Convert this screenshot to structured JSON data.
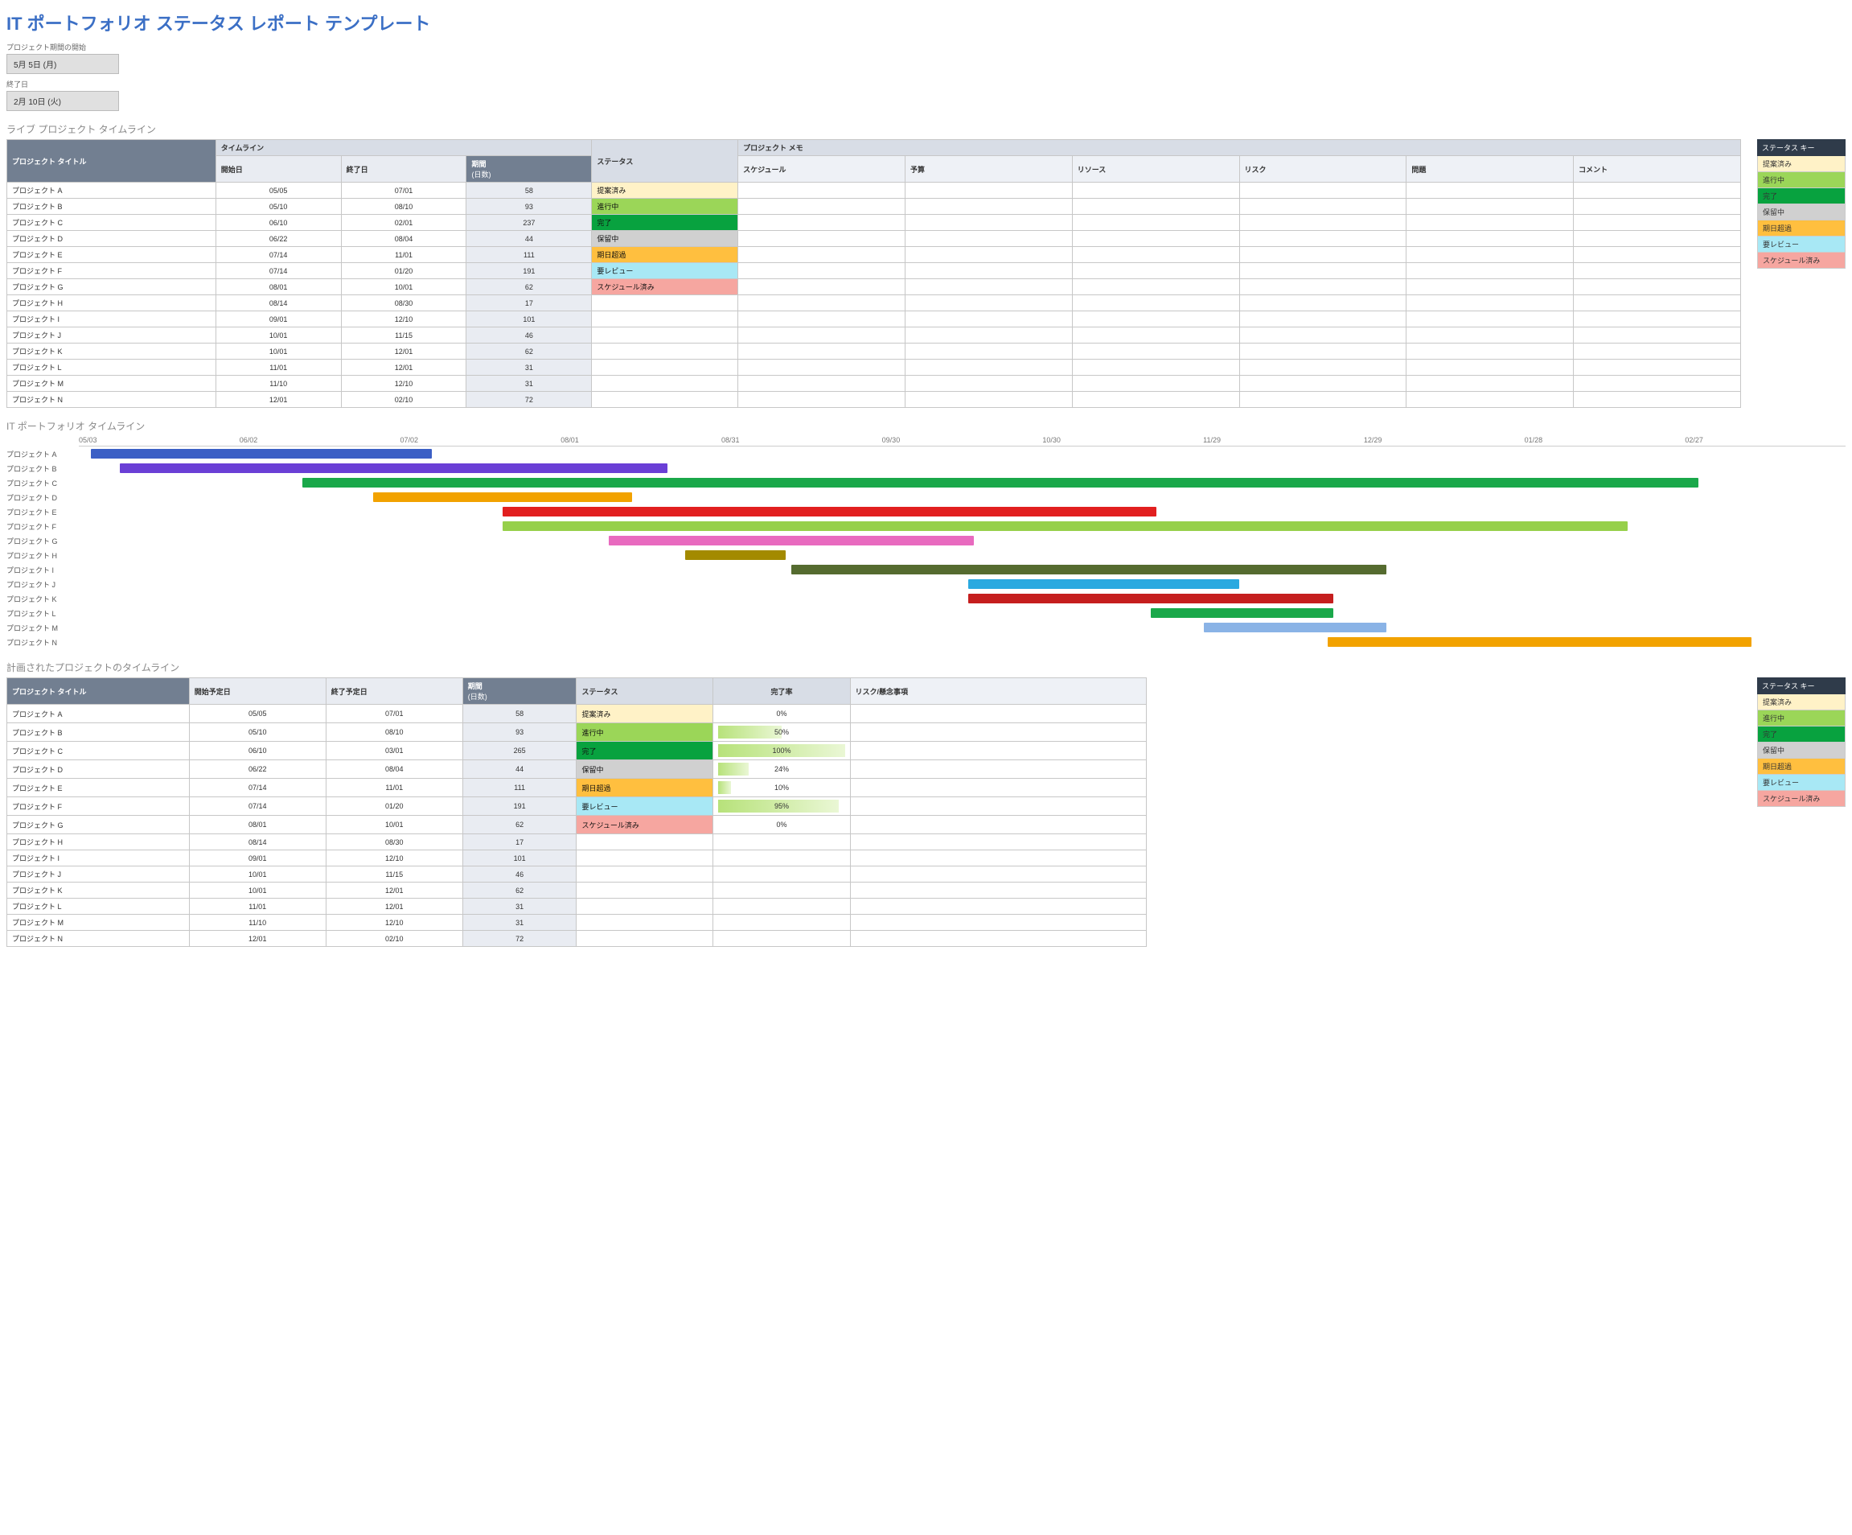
{
  "title": "IT ポートフォリオ ステータス レポート テンプレート",
  "meta": {
    "start_label": "プロジェクト期間の開始",
    "start_value": "5月 5日 (月)",
    "end_label": "終了日",
    "end_value": "2月 10日 (火)"
  },
  "section_live_title": "ライブ プロジェクト タイムライン",
  "live_headers": {
    "group_timeline": "タイムライン",
    "group_memo": "プロジェクト メモ",
    "project_title": "プロジェクト タイトル",
    "start": "開始日",
    "end": "終了日",
    "duration": "期間",
    "duration_sub": "(日数)",
    "status": "ステータス",
    "schedule": "スケジュール",
    "budget": "予算",
    "resource": "リソース",
    "risk": "リスク",
    "issue": "問題",
    "comment": "コメント"
  },
  "live_rows": [
    {
      "title": "プロジェクト A",
      "start": "05/05",
      "end": "07/01",
      "dur": "58",
      "status": "提案済み",
      "scls": "s-proposed"
    },
    {
      "title": "プロジェクト B",
      "start": "05/10",
      "end": "08/10",
      "dur": "93",
      "status": "進行中",
      "scls": "s-progress"
    },
    {
      "title": "プロジェクト C",
      "start": "06/10",
      "end": "02/01",
      "dur": "237",
      "status": "完了",
      "scls": "s-complete"
    },
    {
      "title": "プロジェクト D",
      "start": "06/22",
      "end": "08/04",
      "dur": "44",
      "status": "保留中",
      "scls": "s-hold"
    },
    {
      "title": "プロジェクト E",
      "start": "07/14",
      "end": "11/01",
      "dur": "111",
      "status": "期日超過",
      "scls": "s-overdue"
    },
    {
      "title": "プロジェクト F",
      "start": "07/14",
      "end": "01/20",
      "dur": "191",
      "status": "要レビュー",
      "scls": "s-review"
    },
    {
      "title": "プロジェクト G",
      "start": "08/01",
      "end": "10/01",
      "dur": "62",
      "status": "スケジュール済み",
      "scls": "s-scheduled"
    },
    {
      "title": "プロジェクト H",
      "start": "08/14",
      "end": "08/30",
      "dur": "17",
      "status": "",
      "scls": ""
    },
    {
      "title": "プロジェクト I",
      "start": "09/01",
      "end": "12/10",
      "dur": "101",
      "status": "",
      "scls": ""
    },
    {
      "title": "プロジェクト J",
      "start": "10/01",
      "end": "11/15",
      "dur": "46",
      "status": "",
      "scls": ""
    },
    {
      "title": "プロジェクト K",
      "start": "10/01",
      "end": "12/01",
      "dur": "62",
      "status": "",
      "scls": ""
    },
    {
      "title": "プロジェクト L",
      "start": "11/01",
      "end": "12/01",
      "dur": "31",
      "status": "",
      "scls": ""
    },
    {
      "title": "プロジェクト M",
      "start": "11/10",
      "end": "12/10",
      "dur": "31",
      "status": "",
      "scls": ""
    },
    {
      "title": "プロジェクト N",
      "start": "12/01",
      "end": "02/10",
      "dur": "72",
      "status": "",
      "scls": ""
    }
  ],
  "section_gantt_title": "IT ポートフォリオ タイムライン",
  "gantt_axis": [
    "05/03",
    "06/02",
    "07/02",
    "08/01",
    "08/31",
    "09/30",
    "10/30",
    "11/29",
    "12/29",
    "01/28",
    "02/27"
  ],
  "chart_data": {
    "type": "gantt",
    "title": "IT ポートフォリオ タイムライン",
    "x_ticks": [
      "05/03",
      "06/02",
      "07/02",
      "08/01",
      "08/31",
      "09/30",
      "10/30",
      "11/29",
      "12/29",
      "01/28",
      "02/27"
    ],
    "xlim_days": [
      0,
      300
    ],
    "tasks": [
      {
        "name": "プロジェクト A",
        "start_day": 2,
        "duration": 58,
        "color": "#3b5fc5"
      },
      {
        "name": "プロジェクト B",
        "start_day": 7,
        "duration": 93,
        "color": "#6a3fd6"
      },
      {
        "name": "プロジェクト C",
        "start_day": 38,
        "duration": 237,
        "color": "#1aa84a"
      },
      {
        "name": "プロジェクト D",
        "start_day": 50,
        "duration": 44,
        "color": "#f2a200"
      },
      {
        "name": "プロジェクト E",
        "start_day": 72,
        "duration": 111,
        "color": "#e21f1f"
      },
      {
        "name": "プロジェクト F",
        "start_day": 72,
        "duration": 191,
        "color": "#96d04a"
      },
      {
        "name": "プロジェクト G",
        "start_day": 90,
        "duration": 62,
        "color": "#e86abf"
      },
      {
        "name": "プロジェクト H",
        "start_day": 103,
        "duration": 17,
        "color": "#a38a00"
      },
      {
        "name": "プロジェクト I",
        "start_day": 121,
        "duration": 101,
        "color": "#556b2f"
      },
      {
        "name": "プロジェクト J",
        "start_day": 151,
        "duration": 46,
        "color": "#2aa9e0"
      },
      {
        "name": "プロジェクト K",
        "start_day": 151,
        "duration": 62,
        "color": "#c51e1e"
      },
      {
        "name": "プロジェクト L",
        "start_day": 182,
        "duration": 31,
        "color": "#1aa84a"
      },
      {
        "name": "プロジェクト M",
        "start_day": 191,
        "duration": 31,
        "color": "#8ab3e6"
      },
      {
        "name": "プロジェクト N",
        "start_day": 212,
        "duration": 72,
        "color": "#f2a200"
      }
    ]
  },
  "section_plan_title": "計画されたプロジェクトのタイムライン",
  "plan_headers": {
    "project_title": "プロジェクト タイトル",
    "start": "開始予定日",
    "end": "終了予定日",
    "duration": "期間",
    "duration_sub": "(日数)",
    "status": "ステータス",
    "pct": "完了率",
    "risk": "リスク/懸念事項"
  },
  "plan_rows": [
    {
      "title": "プロジェクト A",
      "start": "05/05",
      "end": "07/01",
      "dur": "58",
      "status": "提案済み",
      "scls": "s-proposed",
      "pct": "0%",
      "pctv": 0
    },
    {
      "title": "プロジェクト B",
      "start": "05/10",
      "end": "08/10",
      "dur": "93",
      "status": "進行中",
      "scls": "s-progress",
      "pct": "50%",
      "pctv": 50
    },
    {
      "title": "プロジェクト C",
      "start": "06/10",
      "end": "03/01",
      "dur": "265",
      "status": "完了",
      "scls": "s-complete",
      "pct": "100%",
      "pctv": 100
    },
    {
      "title": "プロジェクト D",
      "start": "06/22",
      "end": "08/04",
      "dur": "44",
      "status": "保留中",
      "scls": "s-hold",
      "pct": "24%",
      "pctv": 24
    },
    {
      "title": "プロジェクト E",
      "start": "07/14",
      "end": "11/01",
      "dur": "111",
      "status": "期日超過",
      "scls": "s-overdue",
      "pct": "10%",
      "pctv": 10
    },
    {
      "title": "プロジェクト F",
      "start": "07/14",
      "end": "01/20",
      "dur": "191",
      "status": "要レビュー",
      "scls": "s-review",
      "pct": "95%",
      "pctv": 95
    },
    {
      "title": "プロジェクト G",
      "start": "08/01",
      "end": "10/01",
      "dur": "62",
      "status": "スケジュール済み",
      "scls": "s-scheduled",
      "pct": "0%",
      "pctv": 0
    },
    {
      "title": "プロジェクト H",
      "start": "08/14",
      "end": "08/30",
      "dur": "17",
      "status": "",
      "scls": "",
      "pct": "",
      "pctv": -1
    },
    {
      "title": "プロジェクト I",
      "start": "09/01",
      "end": "12/10",
      "dur": "101",
      "status": "",
      "scls": "",
      "pct": "",
      "pctv": -1
    },
    {
      "title": "プロジェクト J",
      "start": "10/01",
      "end": "11/15",
      "dur": "46",
      "status": "",
      "scls": "",
      "pct": "",
      "pctv": -1
    },
    {
      "title": "プロジェクト K",
      "start": "10/01",
      "end": "12/01",
      "dur": "62",
      "status": "",
      "scls": "",
      "pct": "",
      "pctv": -1
    },
    {
      "title": "プロジェクト L",
      "start": "11/01",
      "end": "12/01",
      "dur": "31",
      "status": "",
      "scls": "",
      "pct": "",
      "pctv": -1
    },
    {
      "title": "プロジェクト M",
      "start": "11/10",
      "end": "12/10",
      "dur": "31",
      "status": "",
      "scls": "",
      "pct": "",
      "pctv": -1
    },
    {
      "title": "プロジェクト N",
      "start": "12/01",
      "end": "02/10",
      "dur": "72",
      "status": "",
      "scls": "",
      "pct": "",
      "pctv": -1
    }
  ],
  "status_key": {
    "header": "ステータス キー",
    "items": [
      {
        "label": "提案済み",
        "cls": "s-proposed"
      },
      {
        "label": "進行中",
        "cls": "s-progress"
      },
      {
        "label": "完了",
        "cls": "s-complete"
      },
      {
        "label": "保留中",
        "cls": "s-hold"
      },
      {
        "label": "期日超過",
        "cls": "s-overdue"
      },
      {
        "label": "要レビュー",
        "cls": "s-review"
      },
      {
        "label": "スケジュール済み",
        "cls": "s-scheduled"
      }
    ]
  }
}
